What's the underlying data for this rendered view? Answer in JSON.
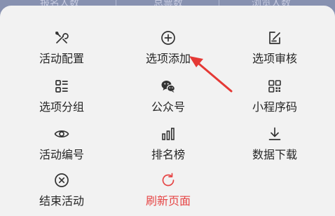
{
  "background_table": {
    "headers": [
      "报名人数",
      "总票数",
      "浏览人数"
    ]
  },
  "menu": {
    "items": [
      {
        "label": "活动配置",
        "icon": "tools-icon"
      },
      {
        "label": "选项添加",
        "icon": "circle-plus-icon"
      },
      {
        "label": "选项审核",
        "icon": "edit-square-icon"
      },
      {
        "label": "选项分组",
        "icon": "group-list-icon"
      },
      {
        "label": "公众号",
        "icon": "wechat-icon"
      },
      {
        "label": "小程序码",
        "icon": "qr-code-icon"
      },
      {
        "label": "活动编号",
        "icon": "eye-icon"
      },
      {
        "label": "排名榜",
        "icon": "bar-chart-icon"
      },
      {
        "label": "数据下载",
        "icon": "download-icon"
      },
      {
        "label": "结束活动",
        "icon": "circle-x-icon"
      },
      {
        "label": "刷新页面",
        "icon": "refresh-icon"
      }
    ]
  },
  "colors": {
    "sheet_bg": "#f2f2f2",
    "text": "#262626",
    "danger": "#e64545",
    "annotation_arrow": "#e53935"
  }
}
